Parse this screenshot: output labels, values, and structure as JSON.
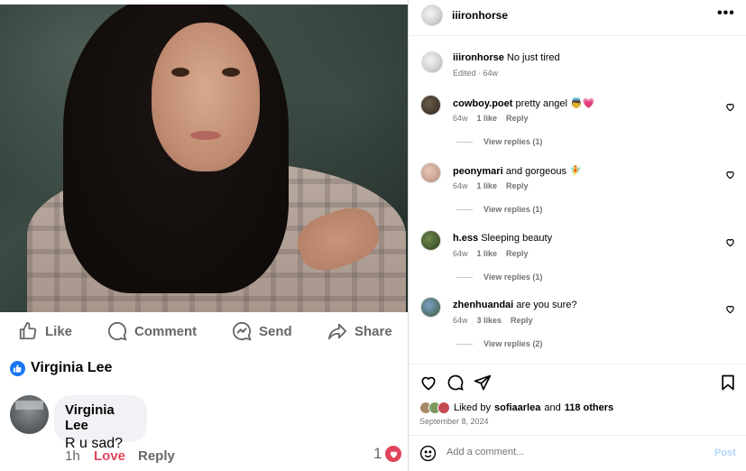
{
  "facebook": {
    "actions": {
      "like": "Like",
      "comment": "Comment",
      "send": "Send",
      "share": "Share"
    },
    "reactor_name": "Virginia Lee",
    "comment": {
      "author": "Virginia Lee",
      "text": "R u sad?",
      "time": "1h",
      "love_label": "Love",
      "reply_label": "Reply",
      "reaction_count": "1"
    }
  },
  "instagram": {
    "header": {
      "username": "iiironhorse",
      "more": "•••"
    },
    "caption": {
      "username": "iiironhorse",
      "text": "No just tired",
      "meta": "Edited · 64w"
    },
    "comments": [
      {
        "username": "cowboy.poet",
        "text": "pretty angel 👼💗",
        "age": "64w",
        "likes": "1 like",
        "reply": "Reply",
        "view_replies": "View replies (1)"
      },
      {
        "username": "peonymari",
        "text": "and gorgeous 🧚",
        "age": "64w",
        "likes": "1 like",
        "reply": "Reply",
        "view_replies": "View replies (1)"
      },
      {
        "username": "h.ess",
        "text": "Sleeping beauty",
        "age": "64w",
        "likes": "1 like",
        "reply": "Reply",
        "view_replies": "View replies (1)"
      },
      {
        "username": "zhenhuandai",
        "text": "are you sure?",
        "age": "64w",
        "likes": "3 likes",
        "reply": "Reply",
        "view_replies": "View replies (2)"
      }
    ],
    "liked_by": {
      "prefix": "Liked by",
      "user": "sofiaarlea",
      "and": "and",
      "others": "118 others"
    },
    "date": "September 8, 2024",
    "add_comment_placeholder": "Add a comment...",
    "post_label": "Post"
  },
  "icons": [
    "like-icon",
    "comment-icon",
    "send-icon",
    "share-icon",
    "heart-icon",
    "share-plane-icon",
    "bookmark-icon",
    "emoji-icon",
    "more-icon"
  ]
}
